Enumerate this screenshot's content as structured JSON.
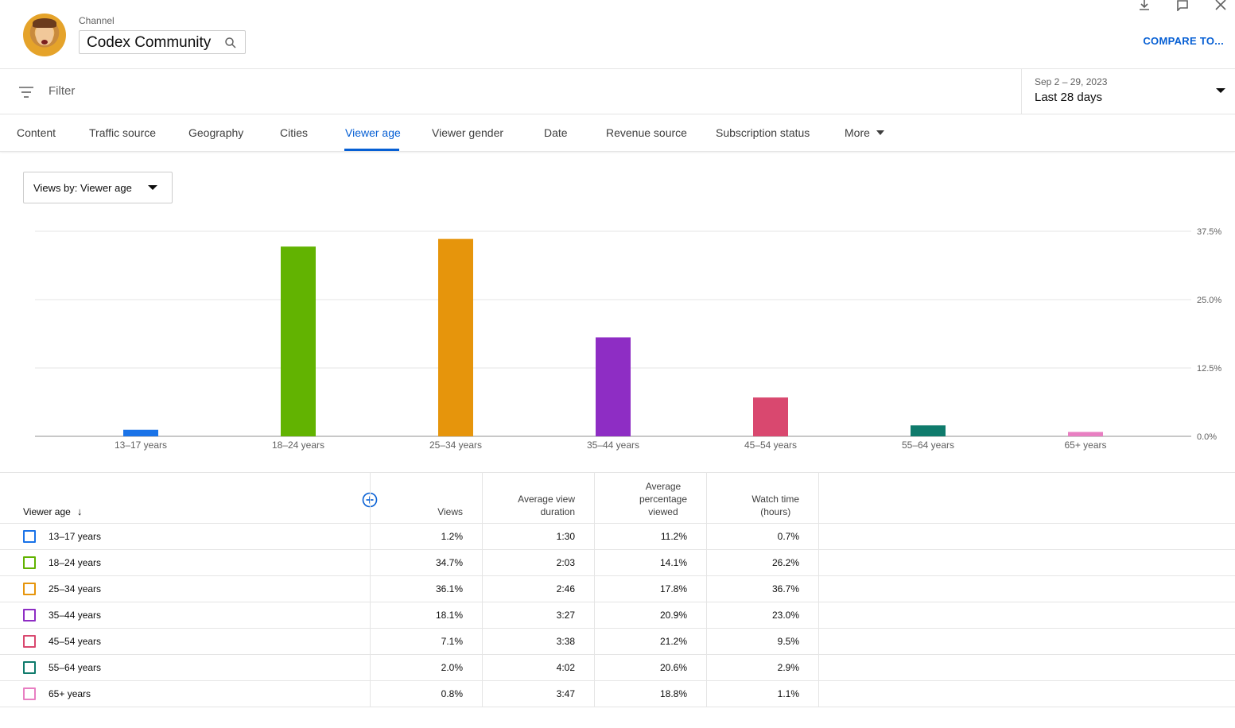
{
  "header": {
    "channel_label": "Channel",
    "channel_name": "Codex Community",
    "compare_label": "COMPARE TO..."
  },
  "filterbar": {
    "filter_placeholder": "Filter",
    "date_range": "Sep 2 – 29, 2023",
    "date_label": "Last 28 days"
  },
  "tabs": [
    {
      "label": "Content"
    },
    {
      "label": "Traffic source"
    },
    {
      "label": "Geography"
    },
    {
      "label": "Cities"
    },
    {
      "label": "Viewer age",
      "active": true
    },
    {
      "label": "Viewer gender"
    },
    {
      "label": "Date"
    },
    {
      "label": "Revenue source"
    },
    {
      "label": "Subscription status"
    },
    {
      "label": "More"
    }
  ],
  "views_dropdown": {
    "label": "Views by: Viewer age"
  },
  "chart_data": {
    "type": "bar",
    "categories": [
      "13–17 years",
      "18–24 years",
      "25–34 years",
      "35–44 years",
      "45–54 years",
      "55–64 years",
      "65+ years"
    ],
    "values": [
      1.2,
      34.7,
      36.1,
      18.1,
      7.1,
      2.0,
      0.8
    ],
    "colors": [
      "#1a73e8",
      "#62b301",
      "#e6950c",
      "#8e2dc4",
      "#d9486f",
      "#0f7b6c",
      "#e87fc2"
    ],
    "ylim": [
      0,
      37.5
    ],
    "yticks": [
      "0.0%",
      "12.5%",
      "25.0%",
      "37.5%"
    ],
    "ytick_values": [
      0,
      12.5,
      25,
      37.5
    ],
    "grid": true,
    "y_axis_side": "right"
  },
  "table": {
    "columns": {
      "viewer_age": "Viewer age",
      "views": "Views",
      "avg_view_duration": [
        "Average view",
        "duration"
      ],
      "avg_pct_viewed": [
        "Average",
        "percentage",
        "viewed"
      ],
      "watch_time": [
        "Watch time",
        "(hours)"
      ]
    },
    "rows": [
      {
        "age": "13–17 years",
        "views": "1.2%",
        "avd": "1:30",
        "apv": "11.2%",
        "wt": "0.7%",
        "color": "#1a73e8"
      },
      {
        "age": "18–24 years",
        "views": "34.7%",
        "avd": "2:03",
        "apv": "14.1%",
        "wt": "26.2%",
        "color": "#62b301"
      },
      {
        "age": "25–34 years",
        "views": "36.1%",
        "avd": "2:46",
        "apv": "17.8%",
        "wt": "36.7%",
        "color": "#e6950c"
      },
      {
        "age": "35–44 years",
        "views": "18.1%",
        "avd": "3:27",
        "apv": "20.9%",
        "wt": "23.0%",
        "color": "#8e2dc4"
      },
      {
        "age": "45–54 years",
        "views": "7.1%",
        "avd": "3:38",
        "apv": "21.2%",
        "wt": "9.5%",
        "color": "#d9486f"
      },
      {
        "age": "55–64 years",
        "views": "2.0%",
        "avd": "4:02",
        "apv": "20.6%",
        "wt": "2.9%",
        "color": "#0f7b6c"
      },
      {
        "age": "65+ years",
        "views": "0.8%",
        "avd": "3:47",
        "apv": "18.8%",
        "wt": "1.1%",
        "color": "#e87fc2"
      }
    ]
  }
}
